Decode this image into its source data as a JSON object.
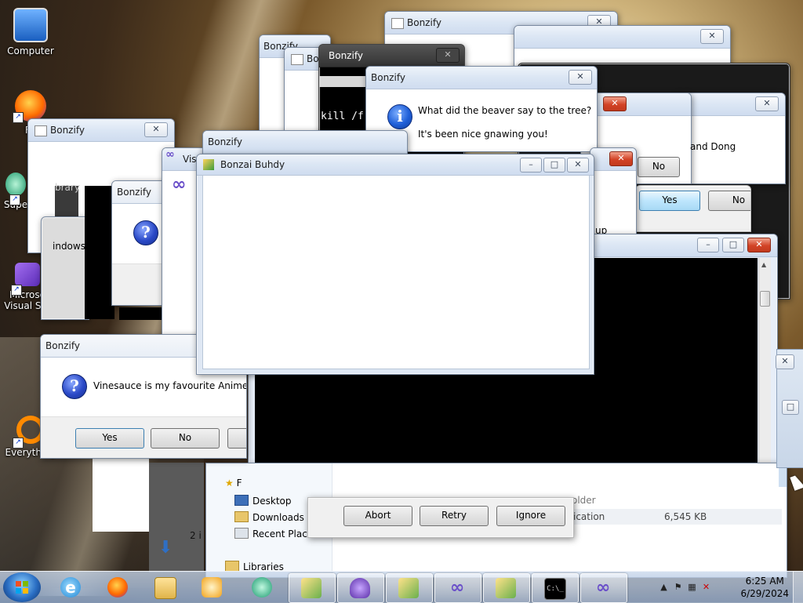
{
  "desktop_icons": [
    {
      "label": "Computer",
      "icon": "computer-icon"
    },
    {
      "label": "Fir",
      "icon": "firefox-icon"
    },
    {
      "label": "Supe",
      "icon": "app-icon"
    },
    {
      "label": "Microso",
      "label2": "Visual Stu",
      "icon": "visual-studio-icon"
    },
    {
      "label": "Everything",
      "icon": "everything-search-icon"
    }
  ],
  "windows": {
    "bonzify_back_top": {
      "title": "Bonzify"
    },
    "bonzify_back_left_top": {
      "title": "Bonzify"
    },
    "bonzify_back_small": {
      "title": "Bo"
    },
    "bonzify_cmd": {
      "title": "Bonzify",
      "command_text": "kill /f"
    },
    "beaver": {
      "title": "Bonzify",
      "line1": "What did the beaver say to the tree?",
      "line2": "It's been nice gnawing you!"
    },
    "right_dong": {
      "title": "",
      "partial_text": "and Dong",
      "no_label": "No"
    },
    "yes_no_right": {
      "yes": "Yes",
      "no": "No"
    },
    "bonzify_left": {
      "title": "Bonzify",
      "partial1": "brary",
      "partial2": "ify",
      "partial3": "indows"
    },
    "bonzify_question_small": {
      "title": "Bonzify"
    },
    "visual_studio": {
      "title": "Visu"
    },
    "bonzify_mid": {
      "title": "Bonzify"
    },
    "bonzai_buddy": {
      "title": "Bonzai Buhdy"
    },
    "vinesauce": {
      "title": "Bonzify",
      "message": "Vinesauce is my favourite Anime",
      "yes": "Yes",
      "no": "No"
    },
    "console_big": {
      "partial": "up"
    },
    "abort_retry": {
      "abort": "Abort",
      "retry": "Retry",
      "ignore": "Ignore"
    },
    "explorer": {
      "nav": [
        "Desktop",
        "Downloads",
        "Recent Places",
        "Libraries"
      ],
      "file_partial": "ication",
      "file_size": "6,545 KB",
      "folder_partial": "older",
      "count_partial": "2 i",
      "fav_partial": "F"
    }
  },
  "taskbar": {
    "items": [
      "internet-explorer-icon",
      "firefox-icon",
      "file-explorer-icon",
      "media-player-icon",
      "bonzi-app-icon",
      "bonzify-installer-icon",
      "bonzi-buddy-icon",
      "bonzify-installer-icon",
      "visual-studio-icon",
      "bonzify-installer-icon",
      "command-prompt-icon",
      "visual-studio-icon"
    ],
    "time": "6:25 AM",
    "date": "6/29/2024"
  }
}
